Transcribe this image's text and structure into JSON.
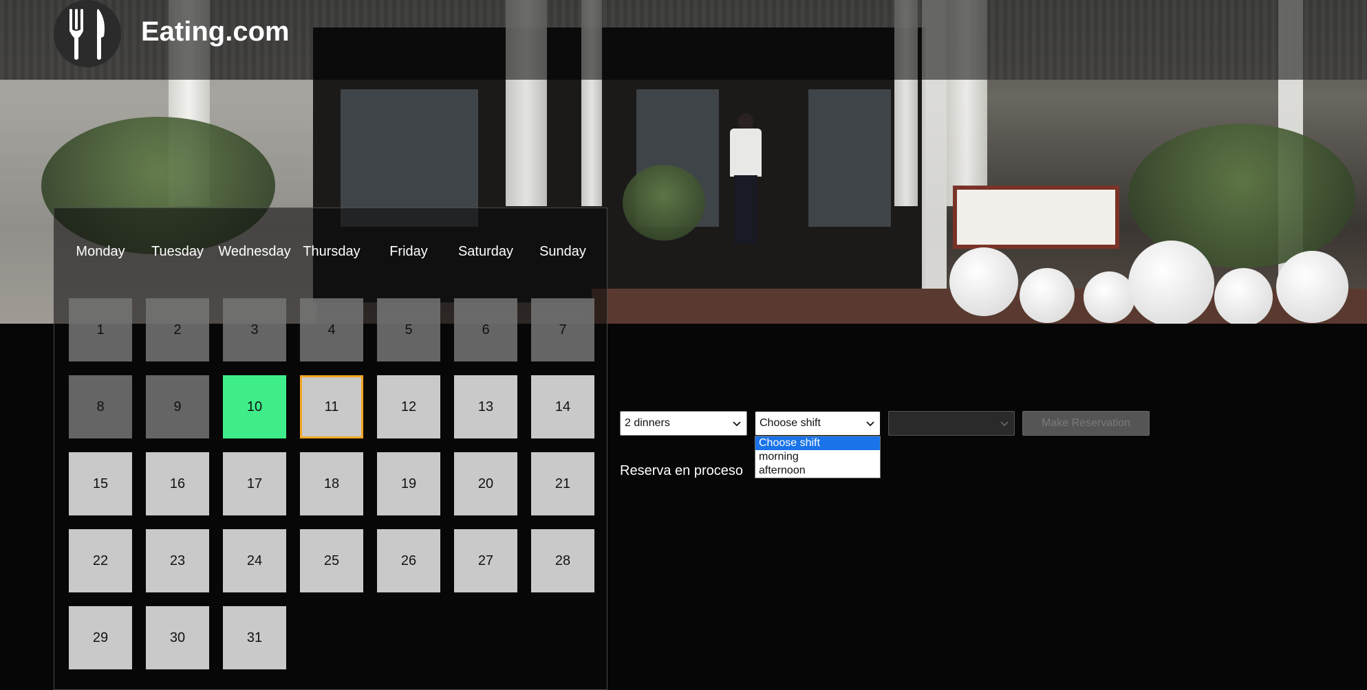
{
  "header": {
    "brand": "Eating.com",
    "logo_icon": "fork-knife-icon"
  },
  "calendar": {
    "weekdays": [
      "Monday",
      "Tuesday",
      "Wednesday",
      "Thursday",
      "Friday",
      "Saturday",
      "Sunday"
    ],
    "days": [
      "1",
      "2",
      "3",
      "4",
      "5",
      "6",
      "7",
      "8",
      "9",
      "10",
      "11",
      "12",
      "13",
      "14",
      "15",
      "16",
      "17",
      "18",
      "19",
      "20",
      "21",
      "22",
      "23",
      "24",
      "25",
      "26",
      "27",
      "28",
      "29",
      "30",
      "31"
    ],
    "past_days": [
      1,
      2,
      3,
      4,
      5,
      6,
      7,
      8,
      9
    ],
    "today": 10,
    "selected": 11,
    "colors": {
      "today": "#3fee8a",
      "selected_border": "#f5a623",
      "available": "#c9c9c9",
      "past": "#767676"
    }
  },
  "reservation": {
    "diners_value": "2 dinners",
    "shift_value": "Choose shift",
    "shift_options": [
      "Choose shift",
      "morning",
      "afternoon"
    ],
    "shift_highlighted": "Choose shift",
    "time_value": "",
    "submit_label": "Make Reservation",
    "status_text": "Reserva en proceso"
  }
}
